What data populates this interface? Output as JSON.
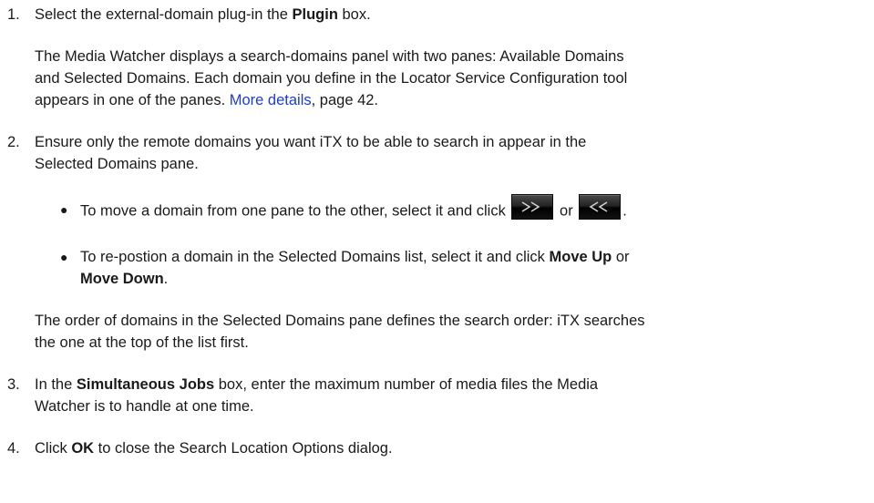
{
  "steps": [
    {
      "number": "1.",
      "pre": "Select the external-domain plug-in the ",
      "bold": "Plugin",
      "post": " box.",
      "detail_lines": [
        "The Media Watcher displays a search-domains panel with two panes: Available Domains",
        "and Selected Domains. Each domain you define in the Locator Service Configuration tool"
      ],
      "detail_last_pre": "appears in one of the panes. ",
      "link_text": "More details",
      "detail_last_post": ", page 42."
    },
    {
      "number": "2.",
      "line1": "Ensure only the remote domains you want iTX to be able to search in appear in the",
      "line2": "Selected Domains pane.",
      "bullets": [
        {
          "pre": "To move a domain from one pane to the other, select it and click ",
          "mid": " or ",
          "post": "."
        },
        {
          "pre": "To re-postion a domain in the Selected Domains list, select it and click ",
          "bold1": "Move Up",
          "mid": " or",
          "bold2": "Move Down",
          "post": "."
        }
      ],
      "note_lines": [
        "The order of domains in the Selected Domains pane defines the search order: iTX searches",
        "the one at the top of the list first."
      ]
    },
    {
      "number": "3.",
      "pre": "In the ",
      "bold": "Simultaneous Jobs",
      "post": " box, enter the maximum number of media files the Media",
      "line2": "Watcher is to handle at one time."
    },
    {
      "number": "4.",
      "pre": "Click ",
      "bold": "OK",
      "post": " to close the Search Location Options dialog."
    }
  ],
  "icons": {
    "move_right": "double-chevron-right-icon",
    "move_left": "double-chevron-left-icon"
  },
  "colors": {
    "link": "#1f3bd6",
    "text": "#1a1a1a"
  }
}
